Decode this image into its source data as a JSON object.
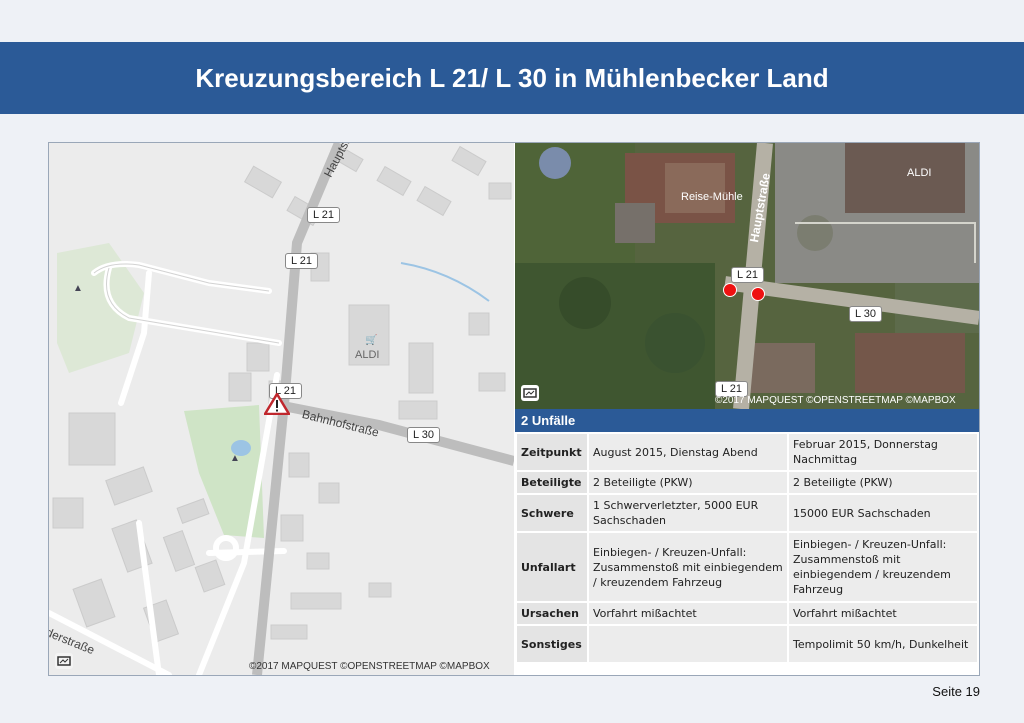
{
  "title": "Kreuzungsbereich L 21/ L 30 in Mühlenbecker Land",
  "street_map": {
    "labels": {
      "l21_top": "L 21",
      "l21_mid": "L 21",
      "l21_cross": "L 21",
      "l30": "L 30"
    },
    "streets": {
      "hauptstrasse": "Hauptstraße",
      "bahnhofstrasse": "Bahnhofstraße",
      "derstrasse": "derstraße"
    },
    "poi": {
      "aldi": "ALDI"
    },
    "credit": "©2017 MAPQUEST ©OPENSTREETMAP ©MAPBOX"
  },
  "sat_map": {
    "labels": {
      "reise_muehle": "Reise-Mühle",
      "aldi": "ALDI",
      "hauptstrasse": "Hauptstraße",
      "l21_top": "L 21",
      "l21_bottom": "L 21",
      "l30": "L 30"
    },
    "credit": "©2017 MAPQUEST ©OPENSTREETMAP ©MAPBOX"
  },
  "accidents": {
    "header": "2 Unfälle",
    "rows": [
      {
        "label": "Zeitpunkt",
        "a": "August 2015, Dienstag Abend",
        "b": "Februar 2015, Donnerstag Nachmittag"
      },
      {
        "label": "Beteiligte",
        "a": "2 Beteiligte (PKW)",
        "b": "2 Beteiligte (PKW)"
      },
      {
        "label": "Schwere",
        "a": "1 Schwerverletzter, 5000 EUR Sachschaden",
        "b": "15000 EUR Sachschaden"
      },
      {
        "label": "Unfallart",
        "a": "Einbiegen- / Kreuzen-Unfall: Zusammenstoß mit einbiegendem / kreuzendem Fahrzeug",
        "b": "Einbiegen- / Kreuzen-Unfall: Zusammenstoß mit einbiegendem / kreuzendem Fahrzeug"
      },
      {
        "label": "Ursachen",
        "a": "Vorfahrt mißachtet",
        "b": "Vorfahrt mißachtet"
      },
      {
        "label": "Sonstiges",
        "a": "",
        "b": "Tempolimit 50 km/h, Dunkelheit"
      }
    ]
  },
  "page": "Seite 19",
  "colors": {
    "accent": "#2b5a97",
    "marker": "#e11111",
    "warning": "#c0272d"
  },
  "icons": [
    "warning-triangle-icon",
    "layers-icon",
    "cart-icon",
    "tree-icon"
  ]
}
